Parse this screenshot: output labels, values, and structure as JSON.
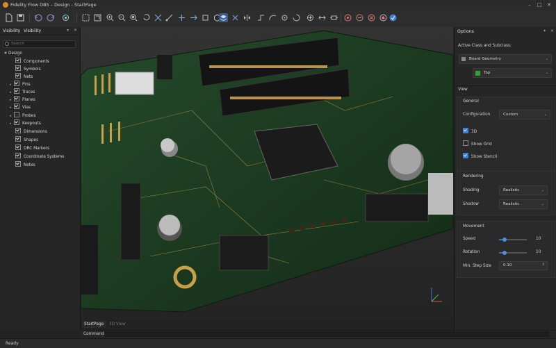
{
  "window": {
    "title": "Fidelity Flow DBS – Design - StartPage",
    "minimize": "–",
    "maximize": "□",
    "close": "✕"
  },
  "toolbar": {
    "icons": [
      "new-file",
      "save",
      "undo",
      "redo",
      "settings",
      "select",
      "zoom-fit",
      "zoom-in",
      "zoom-out",
      "zoom-area",
      "rotate",
      "snap",
      "measure",
      "view-top",
      "view-side",
      "view-front",
      "view-3d",
      "cut",
      "layers",
      "flip",
      "mirror",
      "route",
      "arc",
      "via",
      "align",
      "distribute",
      "fit",
      "component",
      "orbit",
      "drc",
      "highlight",
      "record",
      "share"
    ]
  },
  "left_panel": {
    "tabs": [
      "Visibility",
      "Visibility"
    ],
    "search_placeholder": "Search",
    "tree": [
      {
        "label": "Design",
        "level": 0,
        "expanded": true
      },
      {
        "label": "Components",
        "level": 1,
        "checked": true
      },
      {
        "label": "Symbols",
        "level": 1,
        "checked": true
      },
      {
        "label": "Nets",
        "level": 1,
        "checked": true
      },
      {
        "label": "Pins",
        "level": 1,
        "checked": true,
        "arrow": true
      },
      {
        "label": "Traces",
        "level": 1,
        "checked": true,
        "arrow": true
      },
      {
        "label": "Planes",
        "level": 1,
        "checked": true,
        "arrow": true
      },
      {
        "label": "Vias",
        "level": 1,
        "checked": true,
        "arrow": true
      },
      {
        "label": "Probes",
        "level": 1,
        "checked": false,
        "arrow": true
      },
      {
        "label": "Keepouts",
        "level": 1,
        "checked": true,
        "arrow": true
      },
      {
        "label": "Dimensions",
        "level": 1,
        "checked": true
      },
      {
        "label": "Shapes",
        "level": 1,
        "checked": true
      },
      {
        "label": "DRC Markers",
        "level": 1,
        "checked": true
      },
      {
        "label": "Coordinate Systems",
        "level": 1,
        "checked": true
      },
      {
        "label": "Notes",
        "level": 1,
        "checked": true
      }
    ]
  },
  "doc_tabs": [
    "StartPage",
    "3D View"
  ],
  "command": {
    "label": "Command"
  },
  "status": {
    "text": "Ready"
  },
  "right_panel": {
    "title": "Options",
    "active_class_label": "Active Class and Subclass:",
    "class_value": "Board Geometry",
    "subclass_value": "Top",
    "subclass_color": "#2fa32f",
    "view_title": "View",
    "general": {
      "title": "General",
      "configuration_label": "Configuration",
      "configuration_value": "Custom",
      "checks": [
        {
          "label": "3D",
          "checked": true
        },
        {
          "label": "Show Grid",
          "checked": false
        },
        {
          "label": "Show Stencil",
          "checked": true
        }
      ]
    },
    "rendering": {
      "title": "Rendering",
      "shading_label": "Shading",
      "shading_value": "Realistic",
      "shadow_label": "Shadow",
      "shadow_value": "Realistic"
    },
    "movement": {
      "title": "Movement",
      "speed_label": "Speed",
      "speed_value": "10",
      "speed_fraction": 0.2,
      "rotation_label": "Rotation",
      "rotation_value": "10",
      "rotation_fraction": 0.2,
      "step_label": "Min. Step Size",
      "step_value": "0.10"
    }
  },
  "axis": {
    "z": "Z",
    "y": "Y",
    "x": "X"
  },
  "colors": {
    "accent": "#3d7fd1",
    "board": "#1f3a22",
    "gold": "#c9a04a"
  }
}
